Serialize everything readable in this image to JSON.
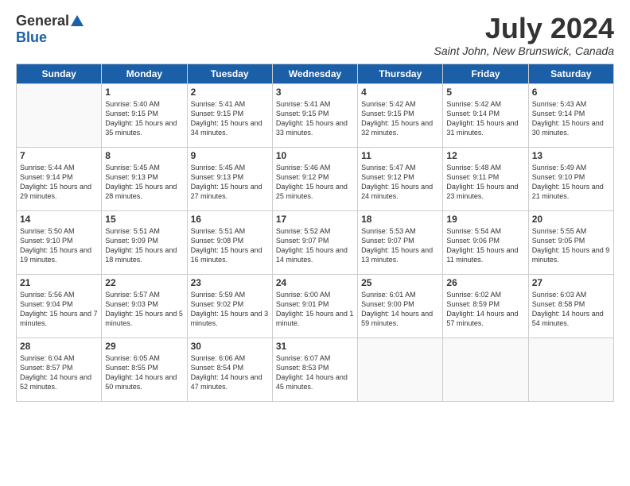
{
  "logo": {
    "general": "General",
    "blue": "Blue"
  },
  "title": "July 2024",
  "location": "Saint John, New Brunswick, Canada",
  "days_of_week": [
    "Sunday",
    "Monday",
    "Tuesday",
    "Wednesday",
    "Thursday",
    "Friday",
    "Saturday"
  ],
  "weeks": [
    [
      {
        "day": "",
        "sunrise": "",
        "sunset": "",
        "daylight": ""
      },
      {
        "day": "1",
        "sunrise": "Sunrise: 5:40 AM",
        "sunset": "Sunset: 9:15 PM",
        "daylight": "Daylight: 15 hours and 35 minutes."
      },
      {
        "day": "2",
        "sunrise": "Sunrise: 5:41 AM",
        "sunset": "Sunset: 9:15 PM",
        "daylight": "Daylight: 15 hours and 34 minutes."
      },
      {
        "day": "3",
        "sunrise": "Sunrise: 5:41 AM",
        "sunset": "Sunset: 9:15 PM",
        "daylight": "Daylight: 15 hours and 33 minutes."
      },
      {
        "day": "4",
        "sunrise": "Sunrise: 5:42 AM",
        "sunset": "Sunset: 9:15 PM",
        "daylight": "Daylight: 15 hours and 32 minutes."
      },
      {
        "day": "5",
        "sunrise": "Sunrise: 5:42 AM",
        "sunset": "Sunset: 9:14 PM",
        "daylight": "Daylight: 15 hours and 31 minutes."
      },
      {
        "day": "6",
        "sunrise": "Sunrise: 5:43 AM",
        "sunset": "Sunset: 9:14 PM",
        "daylight": "Daylight: 15 hours and 30 minutes."
      }
    ],
    [
      {
        "day": "7",
        "sunrise": "Sunrise: 5:44 AM",
        "sunset": "Sunset: 9:14 PM",
        "daylight": "Daylight: 15 hours and 29 minutes."
      },
      {
        "day": "8",
        "sunrise": "Sunrise: 5:45 AM",
        "sunset": "Sunset: 9:13 PM",
        "daylight": "Daylight: 15 hours and 28 minutes."
      },
      {
        "day": "9",
        "sunrise": "Sunrise: 5:45 AM",
        "sunset": "Sunset: 9:13 PM",
        "daylight": "Daylight: 15 hours and 27 minutes."
      },
      {
        "day": "10",
        "sunrise": "Sunrise: 5:46 AM",
        "sunset": "Sunset: 9:12 PM",
        "daylight": "Daylight: 15 hours and 25 minutes."
      },
      {
        "day": "11",
        "sunrise": "Sunrise: 5:47 AM",
        "sunset": "Sunset: 9:12 PM",
        "daylight": "Daylight: 15 hours and 24 minutes."
      },
      {
        "day": "12",
        "sunrise": "Sunrise: 5:48 AM",
        "sunset": "Sunset: 9:11 PM",
        "daylight": "Daylight: 15 hours and 23 minutes."
      },
      {
        "day": "13",
        "sunrise": "Sunrise: 5:49 AM",
        "sunset": "Sunset: 9:10 PM",
        "daylight": "Daylight: 15 hours and 21 minutes."
      }
    ],
    [
      {
        "day": "14",
        "sunrise": "Sunrise: 5:50 AM",
        "sunset": "Sunset: 9:10 PM",
        "daylight": "Daylight: 15 hours and 19 minutes."
      },
      {
        "day": "15",
        "sunrise": "Sunrise: 5:51 AM",
        "sunset": "Sunset: 9:09 PM",
        "daylight": "Daylight: 15 hours and 18 minutes."
      },
      {
        "day": "16",
        "sunrise": "Sunrise: 5:51 AM",
        "sunset": "Sunset: 9:08 PM",
        "daylight": "Daylight: 15 hours and 16 minutes."
      },
      {
        "day": "17",
        "sunrise": "Sunrise: 5:52 AM",
        "sunset": "Sunset: 9:07 PM",
        "daylight": "Daylight: 15 hours and 14 minutes."
      },
      {
        "day": "18",
        "sunrise": "Sunrise: 5:53 AM",
        "sunset": "Sunset: 9:07 PM",
        "daylight": "Daylight: 15 hours and 13 minutes."
      },
      {
        "day": "19",
        "sunrise": "Sunrise: 5:54 AM",
        "sunset": "Sunset: 9:06 PM",
        "daylight": "Daylight: 15 hours and 11 minutes."
      },
      {
        "day": "20",
        "sunrise": "Sunrise: 5:55 AM",
        "sunset": "Sunset: 9:05 PM",
        "daylight": "Daylight: 15 hours and 9 minutes."
      }
    ],
    [
      {
        "day": "21",
        "sunrise": "Sunrise: 5:56 AM",
        "sunset": "Sunset: 9:04 PM",
        "daylight": "Daylight: 15 hours and 7 minutes."
      },
      {
        "day": "22",
        "sunrise": "Sunrise: 5:57 AM",
        "sunset": "Sunset: 9:03 PM",
        "daylight": "Daylight: 15 hours and 5 minutes."
      },
      {
        "day": "23",
        "sunrise": "Sunrise: 5:59 AM",
        "sunset": "Sunset: 9:02 PM",
        "daylight": "Daylight: 15 hours and 3 minutes."
      },
      {
        "day": "24",
        "sunrise": "Sunrise: 6:00 AM",
        "sunset": "Sunset: 9:01 PM",
        "daylight": "Daylight: 15 hours and 1 minute."
      },
      {
        "day": "25",
        "sunrise": "Sunrise: 6:01 AM",
        "sunset": "Sunset: 9:00 PM",
        "daylight": "Daylight: 14 hours and 59 minutes."
      },
      {
        "day": "26",
        "sunrise": "Sunrise: 6:02 AM",
        "sunset": "Sunset: 8:59 PM",
        "daylight": "Daylight: 14 hours and 57 minutes."
      },
      {
        "day": "27",
        "sunrise": "Sunrise: 6:03 AM",
        "sunset": "Sunset: 8:58 PM",
        "daylight": "Daylight: 14 hours and 54 minutes."
      }
    ],
    [
      {
        "day": "28",
        "sunrise": "Sunrise: 6:04 AM",
        "sunset": "Sunset: 8:57 PM",
        "daylight": "Daylight: 14 hours and 52 minutes."
      },
      {
        "day": "29",
        "sunrise": "Sunrise: 6:05 AM",
        "sunset": "Sunset: 8:55 PM",
        "daylight": "Daylight: 14 hours and 50 minutes."
      },
      {
        "day": "30",
        "sunrise": "Sunrise: 6:06 AM",
        "sunset": "Sunset: 8:54 PM",
        "daylight": "Daylight: 14 hours and 47 minutes."
      },
      {
        "day": "31",
        "sunrise": "Sunrise: 6:07 AM",
        "sunset": "Sunset: 8:53 PM",
        "daylight": "Daylight: 14 hours and 45 minutes."
      },
      {
        "day": "",
        "sunrise": "",
        "sunset": "",
        "daylight": ""
      },
      {
        "day": "",
        "sunrise": "",
        "sunset": "",
        "daylight": ""
      },
      {
        "day": "",
        "sunrise": "",
        "sunset": "",
        "daylight": ""
      }
    ]
  ]
}
